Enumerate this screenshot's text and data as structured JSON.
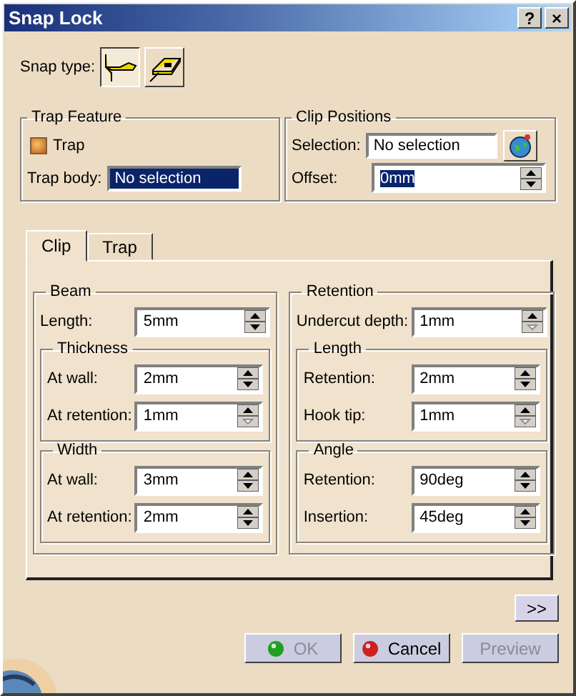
{
  "window": {
    "title": "Snap Lock",
    "help": "?",
    "close": "×"
  },
  "snap_type": {
    "label": "Snap type:",
    "options": [
      {
        "kind": "hook",
        "selected": true
      },
      {
        "kind": "plate",
        "selected": false
      }
    ]
  },
  "trap_feature": {
    "title": "Trap Feature",
    "trap": {
      "label": "Trap",
      "checked": true
    },
    "trap_body": {
      "label": "Trap body:",
      "value": "No selection",
      "selected": true
    }
  },
  "clip_positions": {
    "title": "Clip Positions",
    "selection": {
      "label": "Selection:",
      "value": "No selection"
    },
    "offset": {
      "label": "Offset:",
      "value": "0mm",
      "selected": true
    }
  },
  "tabs": [
    {
      "label": "Clip",
      "selected": true
    },
    {
      "label": "Trap",
      "selected": false
    }
  ],
  "groups": [
    {
      "title": "Beam",
      "fields": [
        {
          "label": "Length:",
          "value": "5mm",
          "down_disabled": false
        }
      ],
      "subgroups": [
        {
          "title": "Thickness",
          "fields": [
            {
              "label": "At wall:",
              "value": "2mm",
              "down_disabled": false
            },
            {
              "label": "At retention:",
              "value": "1mm",
              "down_disabled": true
            }
          ]
        },
        {
          "title": "Width",
          "fields": [
            {
              "label": "At wall:",
              "value": "3mm",
              "down_disabled": false
            },
            {
              "label": "At retention:",
              "value": "2mm",
              "down_disabled": false
            }
          ]
        }
      ]
    },
    {
      "title": "Retention",
      "fields": [
        {
          "label": "Undercut depth:",
          "value": "1mm",
          "down_disabled": true
        }
      ],
      "subgroups": [
        {
          "title": "Length",
          "fields": [
            {
              "label": "Retention:",
              "value": "2mm",
              "down_disabled": false
            },
            {
              "label": "Hook tip:",
              "value": "1mm",
              "down_disabled": true
            }
          ]
        },
        {
          "title": "Angle",
          "fields": [
            {
              "label": "Retention:",
              "value": "90deg",
              "down_disabled": false
            },
            {
              "label": "Insertion:",
              "value": "45deg",
              "down_disabled": false
            }
          ]
        }
      ]
    }
  ],
  "more_button": ">>",
  "buttons": [
    {
      "kind": "ok",
      "label": "OK",
      "disabled": true
    },
    {
      "kind": "cancel",
      "label": "Cancel",
      "disabled": false
    },
    {
      "kind": "preview",
      "label": "Preview",
      "disabled": true
    }
  ]
}
